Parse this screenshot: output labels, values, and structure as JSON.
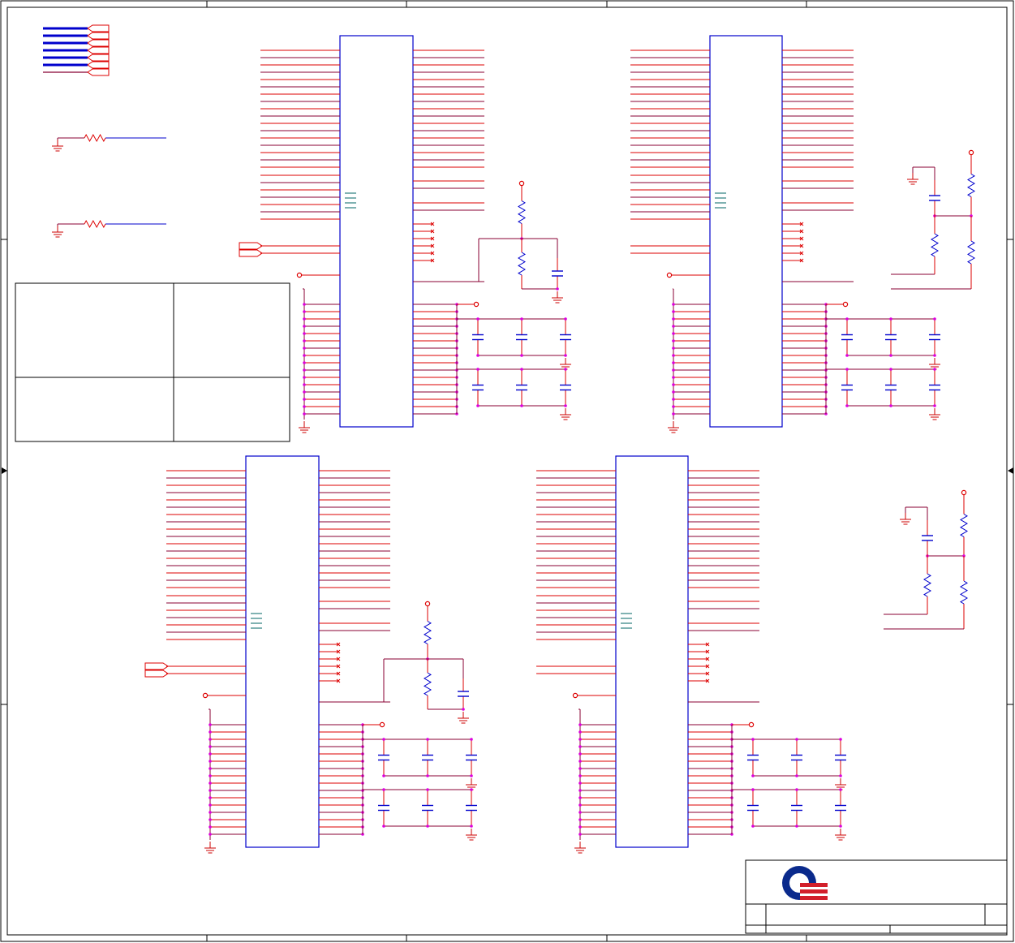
{
  "title_block": {
    "logo": "company-logo",
    "rows": []
  },
  "colors": {
    "border": "#000000",
    "chip_outline": "#0000cc",
    "net_red": "#dd0000",
    "net_dark": "#880033",
    "bus_blue": "#0000cc",
    "junction": "#dd00dd",
    "ground": "#cc0000",
    "logo_blue": "#0a2a8c",
    "logo_red": "#d21f2b"
  },
  "sheet": {
    "zone_markers": 5,
    "chips": 4,
    "termination_networks": 4,
    "decoupling_capacitor_banks": 4
  }
}
